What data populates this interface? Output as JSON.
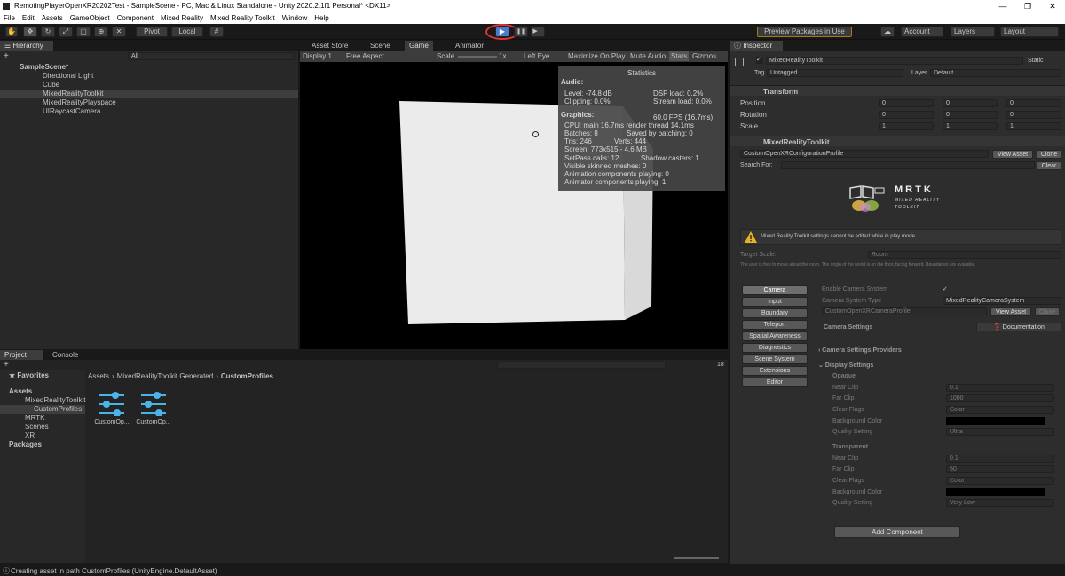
{
  "window": {
    "title": "RemotingPlayerOpenXR20202Test - SampleScene - PC, Mac & Linux Standalone - Unity 2020.2.1f1 Personal* <DX11>",
    "min": "—",
    "max": "❐",
    "close": "✕"
  },
  "menu": [
    "File",
    "Edit",
    "Assets",
    "GameObject",
    "Component",
    "Mixed Reality",
    "Mixed Reality Toolkit",
    "Window",
    "Help"
  ],
  "toolbar": {
    "pivot": "Pivot",
    "local": "Local",
    "preview": "Preview Packages in Use",
    "account": "Account",
    "layers": "Layers",
    "layout": "Layout",
    "play": "▶",
    "pause": "❚❚",
    "step": "▶❘"
  },
  "hierarchy": {
    "tab": "Hierarchy",
    "search_placeholder": "All",
    "scene": "SampleScene*",
    "items": [
      "Directional Light",
      "Cube",
      "MixedRealityToolkit",
      "MixedRealityPlayspace",
      "UIRaycastCamera"
    ]
  },
  "center": {
    "tabs": [
      "Asset Store",
      "Scene",
      "Game",
      "Animator"
    ],
    "game_toolbar": {
      "display": "Display 1",
      "aspect": "Free Aspect",
      "scale_label": "Scale",
      "scale_value": "1x",
      "eye": "Left Eye",
      "maximize": "Maximize On Play",
      "mute": "Mute Audio",
      "stats": "Stats",
      "gizmos": "Gizmos"
    }
  },
  "stats": {
    "title": "Statistics",
    "audio": "Audio:",
    "level": "Level: -74.8 dB",
    "clipping": "Clipping: 0.0%",
    "dsp": "DSP load: 0.2%",
    "stream": "Stream load: 0.0%",
    "graphics": "Graphics:",
    "fps": "60.0 FPS (16.7ms)",
    "cpu": "CPU: main 16.7ms  render thread 14.1ms",
    "batches": "Batches: 8",
    "saved": "Saved by batching: 0",
    "tris": "Tris: 246",
    "verts": "Verts: 444",
    "screen": "Screen: 773x515 - 4.6 MB",
    "setpass": "SetPass calls: 12",
    "shadow": "Shadow casters: 1",
    "skinned": "Visible skinned meshes: 0",
    "anim": "Animation components playing: 0",
    "animator": "Animator components playing: 1"
  },
  "project": {
    "tabs": [
      "Project",
      "Console"
    ],
    "favorites": "Favorites",
    "assets": "Assets",
    "tree": [
      "MixedRealityToolkit",
      "CustomProfiles",
      "MRTK",
      "Scenes",
      "XR"
    ],
    "packages": "Packages",
    "breadcrumb": [
      "Assets",
      "MixedRealityToolkit.Generated",
      "CustomProfiles"
    ],
    "files": [
      "CustomOp...",
      "CustomOp..."
    ],
    "count": "18"
  },
  "inspector": {
    "tab": "Inspector",
    "object": "MixedRealityToolkit",
    "static": "Static",
    "tag_label": "Tag",
    "tag": "Untagged",
    "layer_label": "Layer",
    "layer": "Default",
    "transform": {
      "title": "Transform",
      "rows": [
        {
          "label": "Position",
          "x": "0",
          "y": "0",
          "z": "0"
        },
        {
          "label": "Rotation",
          "x": "0",
          "y": "0",
          "z": "0"
        },
        {
          "label": "Scale",
          "x": "1",
          "y": "1",
          "z": "1"
        }
      ]
    },
    "mrtk": {
      "title": "MixedRealityToolkit",
      "profile": "CustomOpenXRConfigurationProfile",
      "view_asset": "View Asset",
      "clone": "Clone",
      "search_for": "Search For:",
      "clear": "Clear",
      "logo_title": "MRTK",
      "logo_sub1": "MIXED REALITY",
      "logo_sub2": "TOOLKIT",
      "warning": "Mixed Reality Toolkit settings cannot be edited while in play mode.",
      "target_scale_label": "Target Scale:",
      "target_scale": "Room",
      "target_desc": "The user is free to move about the room. The origin of the world is on the floor, facing forward. Boundaries are available."
    },
    "nav": [
      "Camera",
      "Input",
      "Boundary",
      "Teleport",
      "Spatial Awareness",
      "Diagnostics",
      "Scene System",
      "Extensions",
      "Editor"
    ],
    "camera": {
      "enable": "Enable Camera System",
      "check": "✓",
      "system_type_label": "Camera System Type",
      "system_type": "MixedRealityCameraSystem",
      "profile": "CustomOpenXRCameraProfile",
      "view_asset": "View Asset",
      "clone": "Clone",
      "settings": "Camera Settings",
      "documentation": "Documentation",
      "providers": "Camera Settings Providers",
      "display": "Display Settings",
      "opaque": {
        "title": "Opaque",
        "near_label": "Near Clip",
        "near": "0.1",
        "far_label": "Far Clip",
        "far": "1000",
        "flags_label": "Clear Flags",
        "flags": "Color",
        "bg_label": "Background Color",
        "quality_label": "Quality Setting",
        "quality": "Ultra"
      },
      "transparent": {
        "title": "Transparent",
        "near_label": "Near Clip",
        "near": "0.1",
        "far_label": "Far Clip",
        "far": "50",
        "flags_label": "Clear Flags",
        "flags": "Color",
        "bg_label": "Background Color",
        "quality_label": "Quality Setting",
        "quality": "Very Low"
      }
    },
    "add_component": "Add Component"
  },
  "status": "Creating asset in path CustomProfiles (UnityEngine.DefaultAsset)"
}
